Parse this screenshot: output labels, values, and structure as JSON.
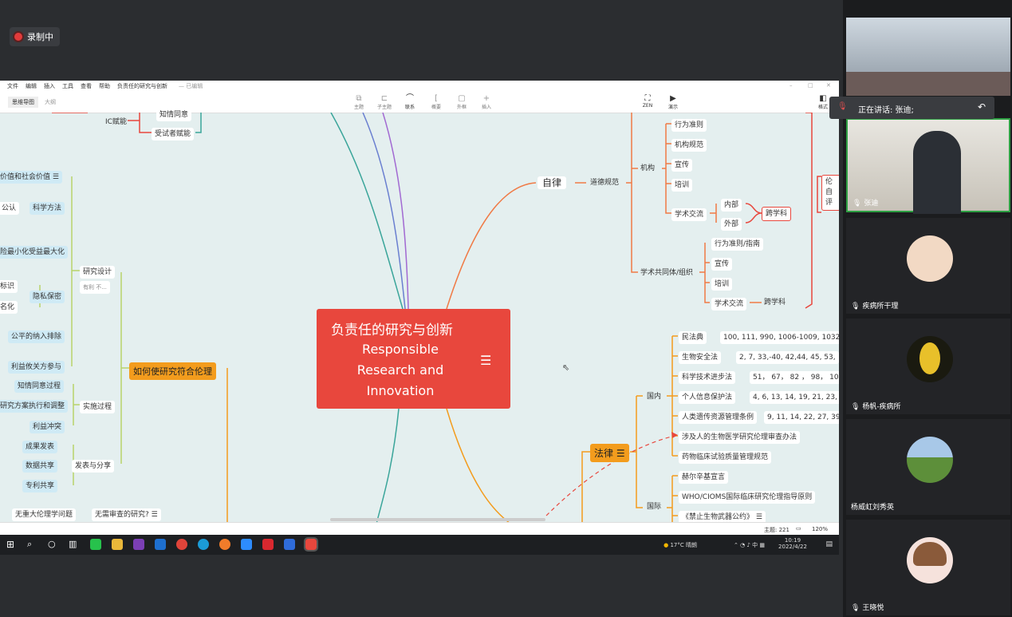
{
  "recording": {
    "label": "录制中"
  },
  "app": {
    "menus": [
      "文件",
      "编辑",
      "插入",
      "工具",
      "查看",
      "帮助"
    ],
    "doc_title": "负责任的研究与创新",
    "doc_status": "— 已编辑",
    "tabs": {
      "mindmap": "思维导图",
      "outline": "大纲"
    },
    "toolbar_left": [
      "主题",
      "子主题",
      "联系",
      "概要",
      "外框",
      "插入"
    ],
    "toolbar_right": [
      "ZEN",
      "演示"
    ],
    "format_label": "格式"
  },
  "map": {
    "center": {
      "cn": "负责任的研究与创新",
      "en": "Responsible Research and Innovation"
    },
    "top_left": {
      "ic": "IC赋能",
      "n1": "知情同意",
      "n2": "受试者赋能"
    },
    "left_branch": {
      "design": "研究设计",
      "design_note": "有利 不...",
      "value": "价值和社会价值",
      "sci_pre": "公认",
      "sci": "科学方法",
      "benefit": "险最小化受益最大化",
      "priv_a": "标识",
      "priv_b": "名化",
      "privacy": "隐私保密",
      "fair": "公平的纳入排除",
      "stake": "利益攸关方参与",
      "main": "如何使研究符合伦理",
      "consent": "知情同意过程",
      "exec": "研究方案执行和调整",
      "conflict": "利益冲突",
      "implement": "实施过程",
      "publish": "成果发表",
      "data": "数据共享",
      "patent": "专利共享",
      "share": "发表与分享",
      "no_major": "无重大伦理学问题",
      "no_review": "无需审查的研究?"
    },
    "self_disc": {
      "main": "自律",
      "moral": "道德规范",
      "inst": "机构",
      "conduct": "行为准则",
      "norms": "机构规范",
      "promo": "宣传",
      "train": "培训",
      "exchange": "学术交流",
      "internal": "内部",
      "external": "外部",
      "interdisc": "跨学科",
      "academic": "学术共同体/组织",
      "guide": "行为准则/指南",
      "promo2": "宣传",
      "train2": "培训",
      "exchange2": "学术交流",
      "interdisc2": "跨学科",
      "far_right": "伦 自 评"
    },
    "law": {
      "main": "法律",
      "domestic": "国内",
      "civil": "民法典",
      "civil_v": "100, 111, 990, 1006-1009, 1032-103",
      "bio": "生物安全法",
      "bio_v": "2, 7, 33,-40, 42,44, 45, 53,",
      "sci": "科学技术进步法",
      "sci_v": "51， 67， 82 ， 98， 103",
      "pi": "个人信息保护法",
      "pi_v": "4, 6, 13, 14, 19, 21, 23, 26",
      "gen": "人类遗传资源管理条例",
      "gen_v": "9, 11, 14, 22, 27, 39",
      "ethics": "涉及人的生物医学研究伦理审查办法",
      "drug": "药物临床试验质量管理规范",
      "intl": "国际",
      "helsinki": "赫尔辛基宣言",
      "cioms": "WHO/CIOMS国际临床研究伦理指导原则",
      "bwc": "《禁止生物武器公约》"
    }
  },
  "status": {
    "topics": "主题: 221",
    "zoom": "120%"
  },
  "taskbar": {
    "weather": "17°C 晴朗",
    "ime": "中",
    "time": "10:19",
    "date": "2022/4/22"
  },
  "meeting": {
    "speaking": "正在讲话: 张迪;",
    "participants": [
      {
        "name": "张迪"
      },
      {
        "name": "疾病所干理"
      },
      {
        "name": "杨帆-疾病所"
      },
      {
        "name": "杨威虹刘秀英"
      },
      {
        "name": "王晓悦"
      }
    ]
  },
  "colors": {
    "center": "#e8473d",
    "orange": "#f39c1d",
    "node_blue": "#cfeaf5",
    "canvas": "#e4efef"
  }
}
